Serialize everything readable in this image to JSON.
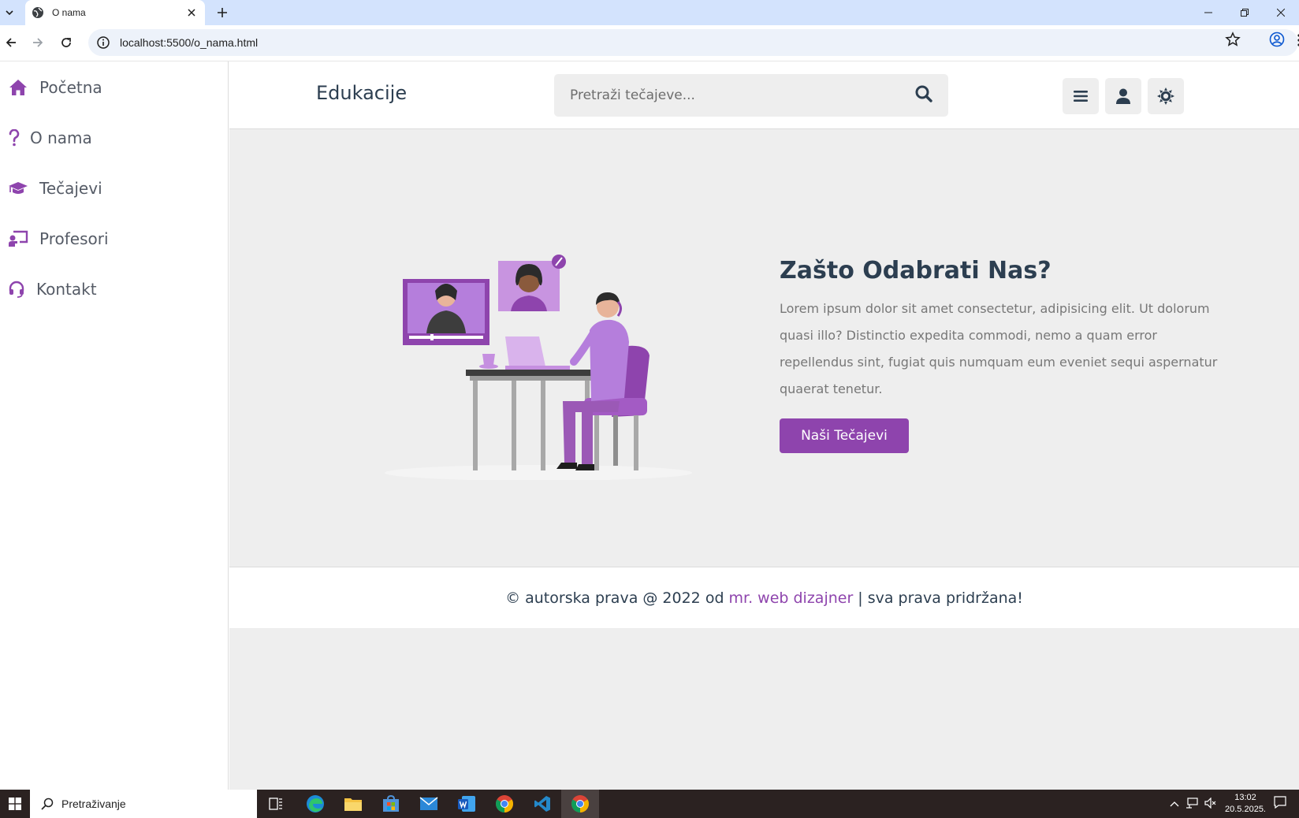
{
  "browser": {
    "tab_title": "O nama",
    "url": "localhost:5500/o_nama.html"
  },
  "sidebar": {
    "items": [
      {
        "label": "Početna",
        "icon": "home-icon"
      },
      {
        "label": "O nama",
        "icon": "question-icon"
      },
      {
        "label": "Tečajevi",
        "icon": "graduation-cap-icon"
      },
      {
        "label": "Profesori",
        "icon": "chalkboard-teacher-icon"
      },
      {
        "label": "Kontakt",
        "icon": "headset-icon"
      }
    ]
  },
  "header": {
    "logo": "Edukacije",
    "search_placeholder": "Pretraži tečajeve..."
  },
  "main": {
    "heading": "Zašto Odabrati Nas?",
    "paragraph": "Lorem ipsum dolor sit amet consectetur, adipisicing elit. Ut dolorum quasi illo? Distinctio expedita commodi, nemo a quam error repellendus sint, fugiat quis numquam eum eveniet sequi aspernatur quaerat tenetur.",
    "button": "Naši Tečajevi"
  },
  "footer": {
    "prefix": "© autorska prava @ 2022 od",
    "brand": "mr. web dizajner",
    "suffix": "| sva prava pridržana!"
  },
  "taskbar": {
    "search_text": "Pretraživanje",
    "time": "13:02",
    "date": "20.5.2025."
  },
  "colors": {
    "accent": "#8e44ad",
    "text_dark": "#2c3e50",
    "background": "#eeeeee"
  }
}
